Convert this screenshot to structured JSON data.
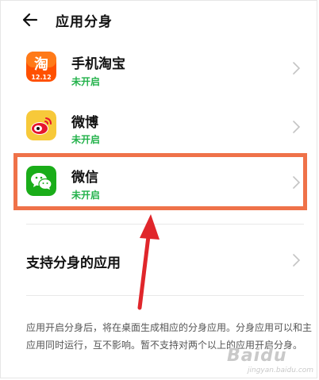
{
  "header": {
    "title": "应用分身",
    "back_icon": "arrow-left-icon"
  },
  "apps": [
    {
      "name": "手机淘宝",
      "status": "未开启",
      "icon": "taobao-icon",
      "icon_badge": "12.12",
      "icon_color": "#ff5000"
    },
    {
      "name": "微博",
      "status": "未开启",
      "icon": "weibo-icon",
      "icon_color": "#f5c518"
    },
    {
      "name": "微信",
      "status": "未开启",
      "icon": "wechat-icon",
      "icon_color": "#1aad19"
    }
  ],
  "support": {
    "label": "支持分身的应用"
  },
  "description": "应用开启分身后，将在桌面生成相应的分身应用。分身应用可以和主应用同时运行，互不影响。暂不支持对两个以上的应用开启分身。",
  "colors": {
    "status_green": "#23b24b",
    "highlight": "#ef7249",
    "annotation_arrow": "#e0262b"
  },
  "watermark": {
    "text": "Baidu",
    "sub": "jingyan.baidu.com"
  }
}
